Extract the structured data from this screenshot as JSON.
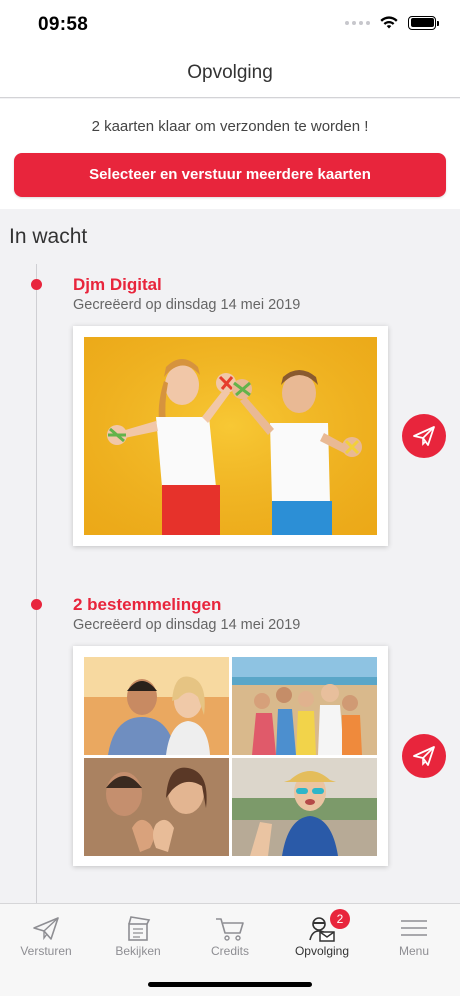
{
  "status": {
    "time": "09:58"
  },
  "header": {
    "title": "Opvolging"
  },
  "banner": {
    "message": "2 kaarten klaar om verzonden te worden !",
    "button_label": "Selecteer en verstuur meerdere kaarten"
  },
  "section": {
    "title": "In wacht"
  },
  "entries": [
    {
      "title": "Djm Digital",
      "date": "Gecreëerd op dinsdag 14 mei 2019"
    },
    {
      "title": "2 bestemmelingen",
      "date": "Gecreëerd op dinsdag 14 mei 2019"
    }
  ],
  "tabs": [
    {
      "label": "Versturen",
      "icon": "paper-plane-icon"
    },
    {
      "label": "Bekijken",
      "icon": "clapperboard-icon"
    },
    {
      "label": "Credits",
      "icon": "cart-icon"
    },
    {
      "label": "Opvolging",
      "icon": "agent-mail-icon",
      "badge": "2"
    },
    {
      "label": "Menu",
      "icon": "hamburger-icon"
    }
  ],
  "colors": {
    "accent": "#e8253c",
    "background": "#f2f2f4"
  }
}
